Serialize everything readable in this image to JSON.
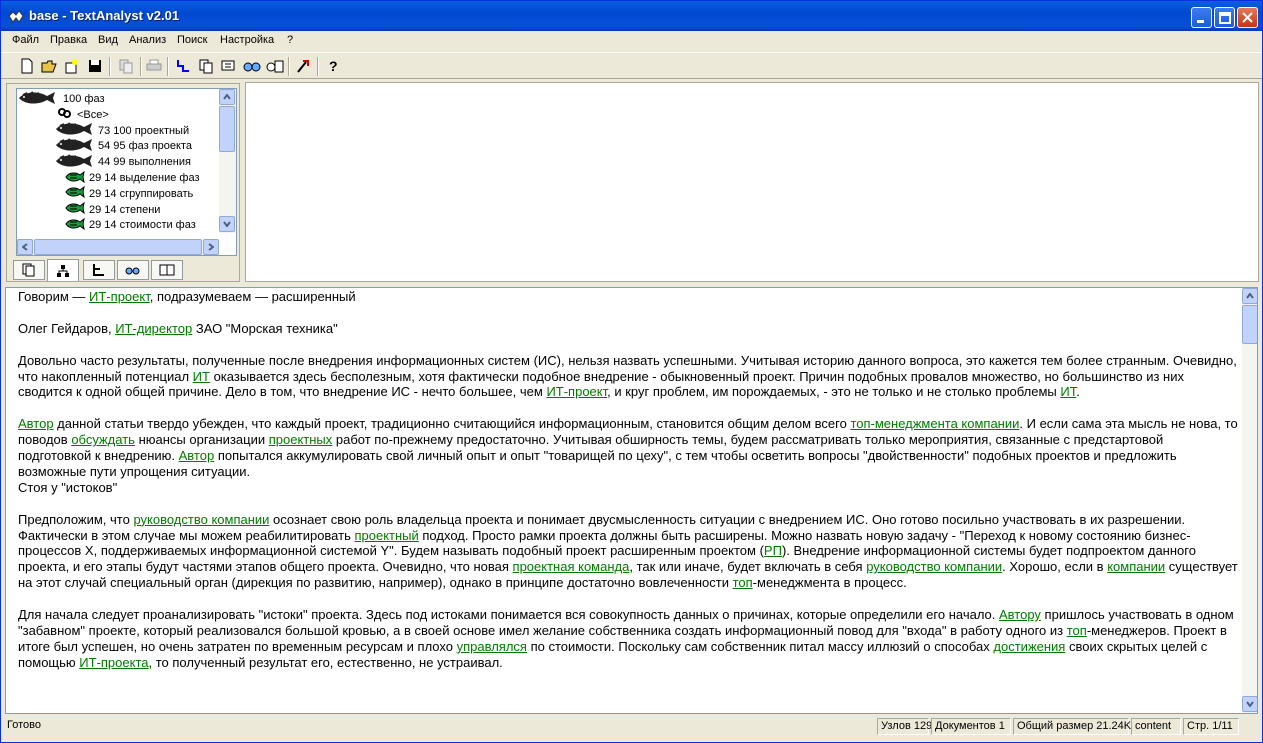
{
  "window": {
    "title": "base - TextAnalyst v2.01"
  },
  "menu": [
    "Файл",
    "Правка",
    "Вид",
    "Анализ",
    "Поиск",
    "Настройка",
    "?"
  ],
  "toolbar": {
    "buttons": [
      "new-icon",
      "open-icon",
      "properties-icon",
      "save-icon",
      "copy-icon",
      "print-icon",
      "tree-icon",
      "documents-icon",
      "analyze-icon",
      "search-icon",
      "replace-icon",
      "settings-icon",
      "help-icon"
    ]
  },
  "tree": {
    "items": [
      {
        "label": "100 фаз",
        "icon": "fish-large-icon"
      },
      {
        "label": "<Все>",
        "icon": "link-icon"
      },
      {
        "label": "73 100 проектный",
        "icon": "fish-large-icon"
      },
      {
        "label": "54 95 фаз проекта",
        "icon": "fish-large-icon"
      },
      {
        "label": "44 99 выполнения",
        "icon": "fish-large-icon"
      },
      {
        "label": "29 14 выделение фаз",
        "icon": "fish-green-icon"
      },
      {
        "label": "29 14 сгруппировать",
        "icon": "fish-green-icon"
      },
      {
        "label": "29 14 степени",
        "icon": "fish-green-icon"
      },
      {
        "label": "29 14 стоимости фаз",
        "icon": "fish-green-icon"
      }
    ]
  },
  "tabs": [
    "documents-tab-icon",
    "tree-tab-icon",
    "structure-tab-icon",
    "search-tab-icon",
    "results-tab-icon"
  ],
  "text": {
    "p1": [
      {
        "t": "Говорим — ",
        "b": true
      },
      {
        "t": "ИТ-проект",
        "l": true
      },
      {
        "t": ", подразумеваем — расширенный"
      }
    ],
    "p2": [
      {
        "t": "Олег Гейдаров, "
      },
      {
        "t": "ИТ-директор",
        "l": true
      },
      {
        "t": " ЗАО \"Морская техника\""
      }
    ],
    "p3": [
      {
        "t": "Довольно часто результаты, полученные после внедрения информационных систем (ИС), нельзя назвать успешными. Учитывая историю данного вопроса, это кажется тем более странным. Очевидно, что накопленный потенциал "
      },
      {
        "t": "ИТ",
        "l": true
      },
      {
        "t": " оказывается здесь бесполезным, хотя фактически подобное внедрение - обыкновенный проект. Причин подобных провалов множество, но большинство из них сводится к одной общей причине. Дело в том, что внедрение ИС - нечто большее, чем "
      },
      {
        "t": "ИТ-проект",
        "l": true
      },
      {
        "t": ", и круг проблем, им порождаемых, - это не только и не столько проблемы "
      },
      {
        "t": "ИТ",
        "l": true
      },
      {
        "t": "."
      }
    ],
    "p4": [
      {
        "t": "Автор",
        "l": true
      },
      {
        "t": " данной статьи твердо убежден, что каждый проект, традиционно считающийся информационным, становится общим делом всего "
      },
      {
        "t": "топ-менеджмента компании",
        "l": true
      },
      {
        "t": ". И если сама эта мысль не нова, то поводов "
      },
      {
        "t": "обсуждать",
        "l": true
      },
      {
        "t": " нюансы организации "
      },
      {
        "t": "проектных",
        "l": true
      },
      {
        "t": " работ по-прежнему предостаточно. Учитывая обширность темы, будем рассматривать только мероприятия, связанные с предстартовой подготовкой к внедрению. "
      },
      {
        "t": "Автор",
        "l": true
      },
      {
        "t": " попытался аккумулировать свой личный опыт и опыт \"товарищей по цеху\", с тем чтобы осветить вопросы \"двойственности\" подобных проектов и предложить возможные пути упрощения ситуации."
      },
      {
        "br": true
      },
      {
        "t": "Стоя у \"истоков\""
      }
    ],
    "p5": [
      {
        "t": "Предположим, что "
      },
      {
        "t": "руководство компании",
        "l": true
      },
      {
        "t": " осознает свою роль владельца проекта и понимает двусмысленность ситуации с внедрением ИС. Оно готово посильно участвовать в их разрешении. Фактически в этом случае мы можем реабилитировать "
      },
      {
        "t": "проектный",
        "l": true
      },
      {
        "t": " подход. Просто рамки проекта должны быть расширены. Можно назвать новую задачу - \"Переход к новому состоянию бизнес-процессов X, поддерживаемых информационной системой Y\". Будем называть подобный проект расширенным проектом ("
      },
      {
        "t": "РП",
        "l": true
      },
      {
        "t": "). Внедрение информационной системы будет подпроектом данного проекта, и его этапы будут частями этапов общего проекта. Очевидно, что новая "
      },
      {
        "t": "проектная команда",
        "l": true
      },
      {
        "t": ", так или иначе, будет включать в себя "
      },
      {
        "t": "руководство компании",
        "l": true
      },
      {
        "t": ". Хорошо, если в "
      },
      {
        "t": "компании",
        "l": true
      },
      {
        "t": " существует на этот случай специальный орган (дирекция по развитию, например), однако в принципе достаточно вовлеченности "
      },
      {
        "t": "топ",
        "l": true
      },
      {
        "t": "-менеджмента в процесс."
      }
    ],
    "p6": [
      {
        "t": "Для начала следует проанализировать \"истоки\" проекта. Здесь под истоками понимается вся совокупность данных о причинах, которые определили его начало. "
      },
      {
        "t": "Автору",
        "l": true
      },
      {
        "t": " пришлось участвовать в одном \"забавном\" проекте, который реализовался большой кровью, а в своей основе имел желание собственника создать информационный повод для \"входа\" в работу одного из "
      },
      {
        "t": "топ",
        "l": true
      },
      {
        "t": "-менеджеров. Проект в итоге был успешен, но очень затратен по временным ресурсам и плохо "
      },
      {
        "t": "управлялся",
        "l": true
      },
      {
        "t": " по стоимости. Поскольку сам собственник питал массу иллюзий о способах "
      },
      {
        "t": "достижения",
        "l": true
      },
      {
        "t": " своих скрытых целей с помощью "
      },
      {
        "t": "ИТ-проекта",
        "l": true
      },
      {
        "t": ", то полученный результат его, естественно, не устраивал."
      }
    ]
  },
  "status": {
    "ready": "Готово",
    "nodes": "Узлов 129",
    "docs": "Документов 1",
    "size": "Общий размер 21.24K",
    "content": "content",
    "page": "Стр. 1/11"
  }
}
